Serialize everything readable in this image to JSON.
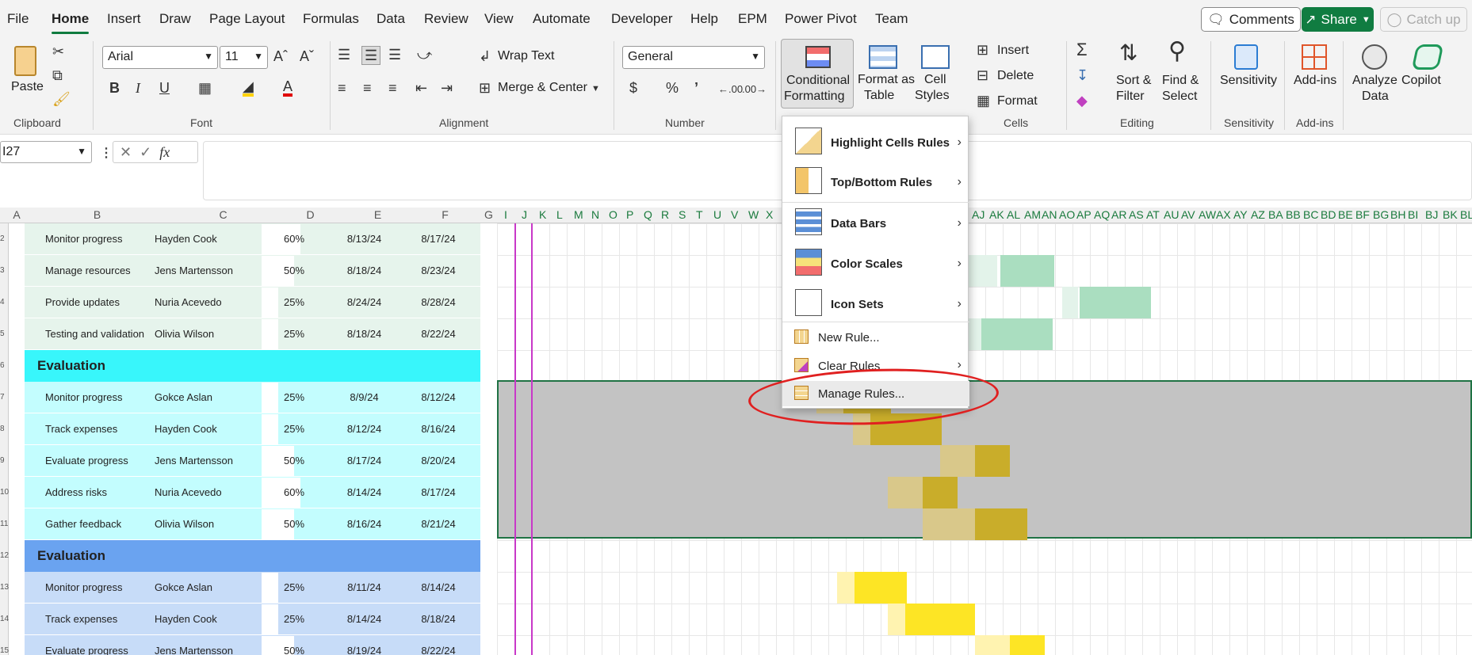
{
  "menu": {
    "tabs": [
      "File",
      "Home",
      "Insert",
      "Draw",
      "Page Layout",
      "Formulas",
      "Data",
      "Review",
      "View",
      "Automate",
      "Developer",
      "Help",
      "EPM",
      "Power Pivot",
      "Team"
    ],
    "active": "Home",
    "comments": "Comments",
    "share": "Share",
    "catch_up": "Catch up"
  },
  "ribbon": {
    "groups": {
      "clipboard": "Clipboard",
      "font": "Font",
      "alignment": "Alignment",
      "number": "Number",
      "cells": "Cells",
      "editing": "Editing",
      "sensitivity": "Sensitivity",
      "addins": "Add-ins"
    },
    "paste": "Paste",
    "font_name": "Arial",
    "font_size": "11",
    "wrap_text": "Wrap Text",
    "merge_center": "Merge & Center",
    "number_format": "General",
    "cf_line1": "Conditional",
    "cf_line2": "Formatting",
    "fat_line1": "Format as",
    "fat_line2": "Table",
    "cs_line1": "Cell",
    "cs_line2": "Styles",
    "insert": "Insert",
    "delete": "Delete",
    "format": "Format",
    "sort_line1": "Sort &",
    "sort_line2": "Filter",
    "find_line1": "Find &",
    "find_line2": "Select",
    "sensitivity_btn": "Sensitivity",
    "addins_btn": "Add-ins",
    "analyze_line1": "Analyze",
    "analyze_line2": "Data",
    "copilot": "Copilot"
  },
  "formula_bar": {
    "name_box": "I27",
    "fx": "fx"
  },
  "columns": {
    "main": [
      "A",
      "B",
      "C",
      "D",
      "E",
      "F",
      "G"
    ],
    "gantt": [
      "I",
      "J",
      "K",
      "L",
      "M",
      "N",
      "O",
      "P",
      "Q",
      "R",
      "S",
      "T",
      "U",
      "V",
      "W",
      "X"
    ],
    "gantt_right": [
      "AJ",
      "AK",
      "AL",
      "AM",
      "AN",
      "AO",
      "AP",
      "AQ",
      "AR",
      "AS",
      "AT",
      "AU",
      "AV",
      "AW",
      "AX",
      "AY",
      "AZ",
      "BA",
      "BB",
      "BC",
      "BD",
      "BE",
      "BF",
      "BG",
      "BH",
      "BI",
      "BJ",
      "BK",
      "BL"
    ]
  },
  "row_numbers": [
    "2",
    "3",
    "4",
    "5",
    "6",
    "7",
    "8",
    "9",
    "10",
    "11",
    "12",
    "13",
    "14",
    "15"
  ],
  "rows": [
    {
      "task": "Monitor progress",
      "owner": "Hayden Cook",
      "pct": "60%",
      "start": "8/13/24",
      "end": "8/17/24",
      "pct_value": 0.6
    },
    {
      "task": "Manage resources",
      "owner": "Jens Martensson",
      "pct": "50%",
      "start": "8/18/24",
      "end": "8/23/24",
      "pct_value": 0.5
    },
    {
      "task": "Provide updates",
      "owner": "Nuria Acevedo",
      "pct": "25%",
      "start": "8/24/24",
      "end": "8/28/24",
      "pct_value": 0.25
    },
    {
      "task": "Testing and validation",
      "owner": "Olivia Wilson",
      "pct": "25%",
      "start": "8/18/24",
      "end": "8/22/24",
      "pct_value": 0.25
    },
    {
      "section": "Evaluation"
    },
    {
      "task": "Monitor progress",
      "owner": "Gokce Aslan",
      "pct": "25%",
      "start": "8/9/24",
      "end": "8/12/24",
      "pct_value": 0.25
    },
    {
      "task": "Track expenses",
      "owner": "Hayden Cook",
      "pct": "25%",
      "start": "8/12/24",
      "end": "8/16/24",
      "pct_value": 0.25
    },
    {
      "task": "Evaluate progress",
      "owner": "Jens Martensson",
      "pct": "50%",
      "start": "8/17/24",
      "end": "8/20/24",
      "pct_value": 0.5
    },
    {
      "task": "Address risks",
      "owner": "Nuria Acevedo",
      "pct": "60%",
      "start": "8/14/24",
      "end": "8/17/24",
      "pct_value": 0.6
    },
    {
      "task": "Gather feedback",
      "owner": "Olivia Wilson",
      "pct": "50%",
      "start": "8/16/24",
      "end": "8/21/24",
      "pct_value": 0.5
    },
    {
      "section": "Evaluation"
    },
    {
      "task": "Monitor progress",
      "owner": "Gokce Aslan",
      "pct": "25%",
      "start": "8/11/24",
      "end": "8/14/24",
      "pct_value": 0.25
    },
    {
      "task": "Track expenses",
      "owner": "Hayden Cook",
      "pct": "25%",
      "start": "8/14/24",
      "end": "8/18/24",
      "pct_value": 0.25
    },
    {
      "task": "Evaluate progress",
      "owner": "Jens Martensson",
      "pct": "50%",
      "start": "8/19/24",
      "end": "8/22/24",
      "pct_value": 0.5
    }
  ],
  "dropdown": {
    "highlight": "Highlight Cells Rules",
    "topbottom": "Top/Bottom Rules",
    "databars": "Data Bars",
    "colorscales": "Color Scales",
    "iconsets": "Icon Sets",
    "newrule": "New Rule...",
    "clearrules": "Clear Rules",
    "managerules": "Manage Rules..."
  },
  "colors": {
    "accent": "#107c41",
    "section1": "#38f6fb",
    "section2": "#6aa3f0",
    "highlight_circle": "#e02020"
  }
}
